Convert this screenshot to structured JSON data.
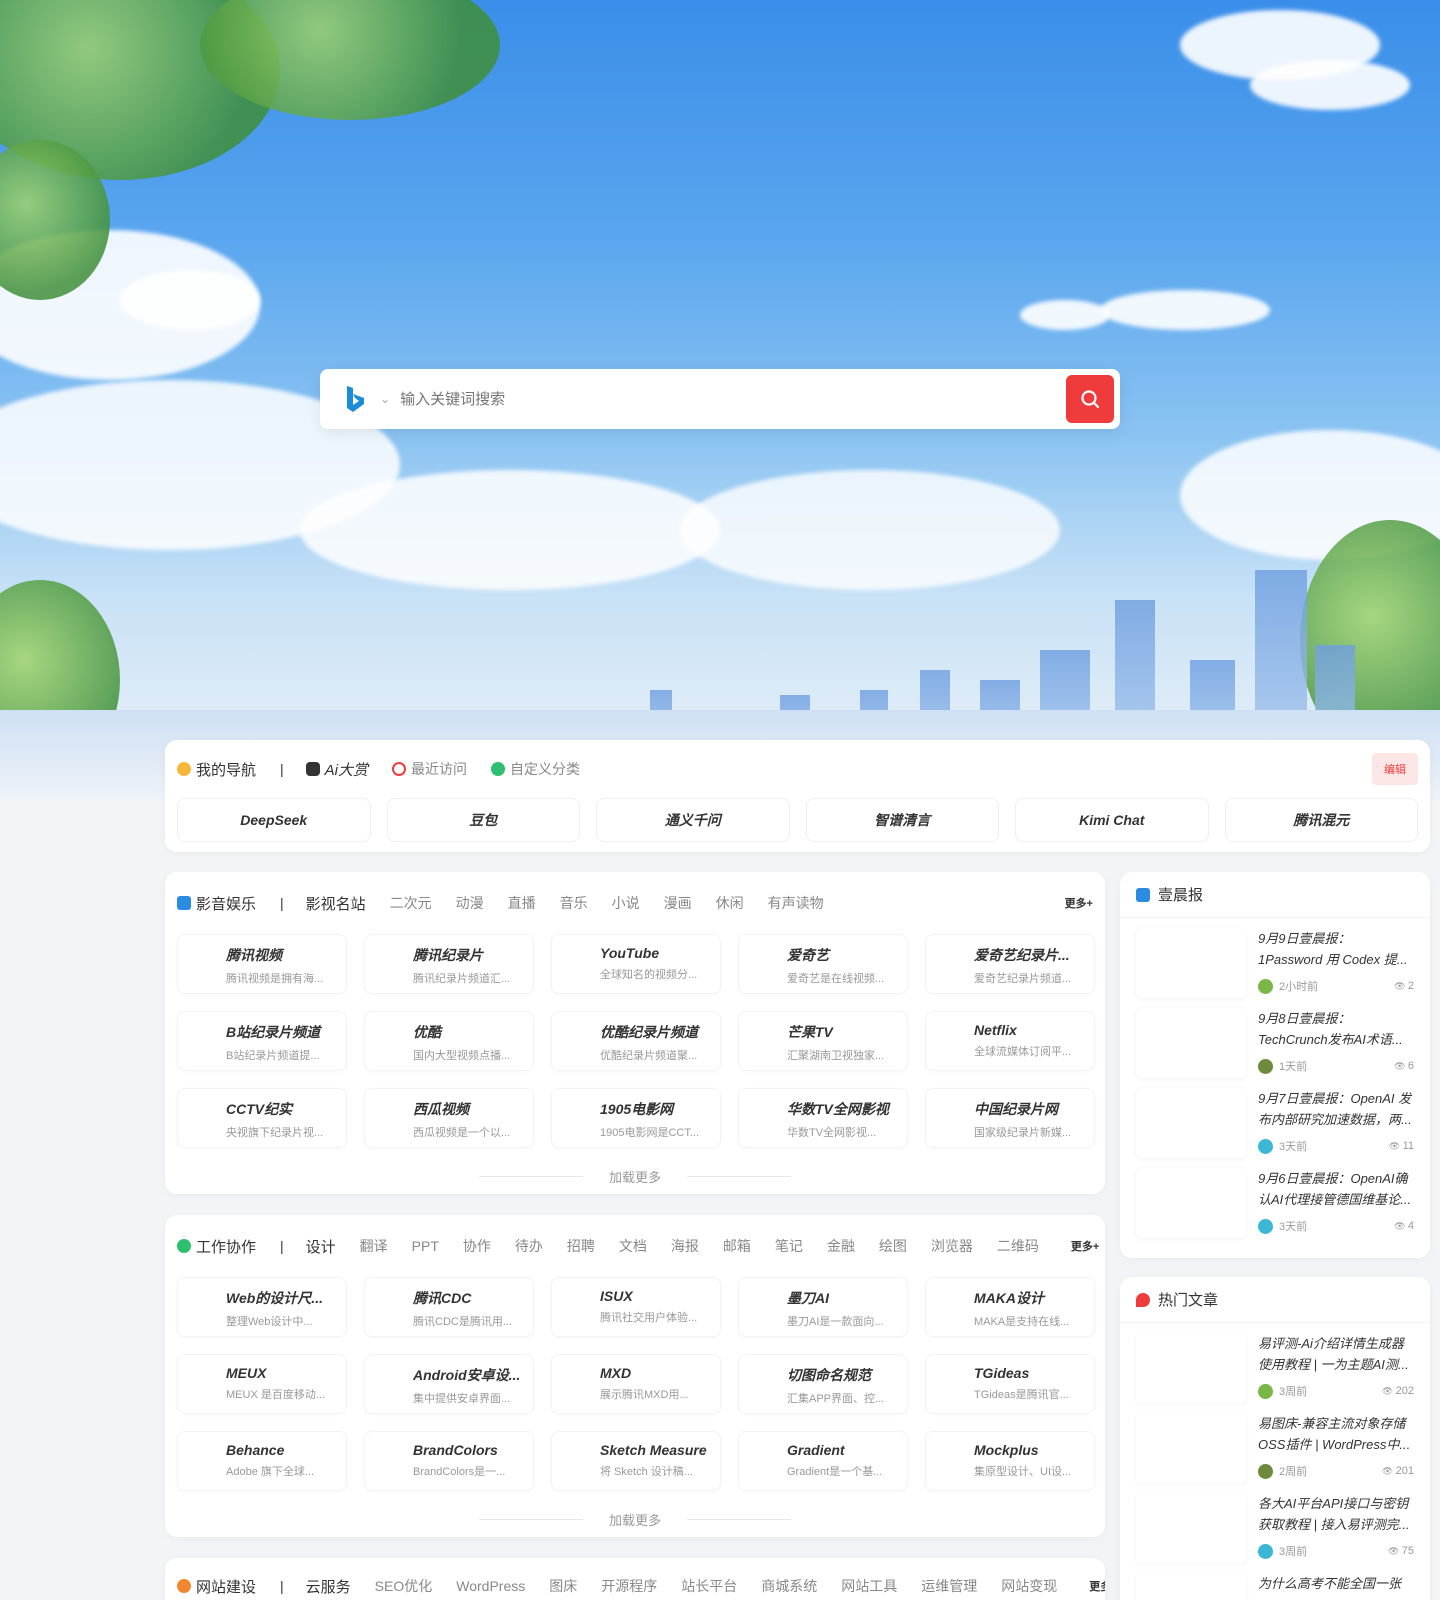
{
  "search": {
    "placeholder": "输入关键词搜索"
  },
  "my_nav": {
    "tabs": [
      {
        "label": "我的导航",
        "icon": "star-icon"
      },
      {
        "label": "Ai大赏",
        "icon": "robot-icon"
      },
      {
        "label": "最近访问",
        "icon": "clock-icon"
      },
      {
        "label": "自定义分类",
        "icon": "plus-circle-icon"
      }
    ],
    "edit_label": "编辑",
    "items": [
      "DeepSeek",
      "豆包",
      "通义千问",
      "智谱清言",
      "Kimi Chat",
      "腾讯混元"
    ]
  },
  "entertainment": {
    "title": "影音娱乐",
    "active_tab": "影视名站",
    "tabs": [
      "二次元",
      "动漫",
      "直播",
      "音乐",
      "小说",
      "漫画",
      "休闲",
      "有声读物"
    ],
    "more": "更多+",
    "sites": [
      {
        "name": "腾讯视频",
        "desc": "腾讯视频是拥有海..."
      },
      {
        "name": "腾讯纪录片",
        "desc": "腾讯纪录片频道汇..."
      },
      {
        "name": "YouTube",
        "desc": "全球知名的视频分..."
      },
      {
        "name": "爱奇艺",
        "desc": "爱奇艺是在线视频..."
      },
      {
        "name": "爱奇艺纪录片...",
        "desc": "爱奇艺纪录片频道..."
      },
      {
        "name": "B站纪录片频道",
        "desc": "B站纪录片频道提..."
      },
      {
        "name": "优酷",
        "desc": "国内大型视频点播..."
      },
      {
        "name": "优酷纪录片频道",
        "desc": "优酷纪录片频道聚..."
      },
      {
        "name": "芒果TV",
        "desc": "汇聚湖南卫视独家..."
      },
      {
        "name": "Netflix",
        "desc": "全球流媒体订阅平..."
      },
      {
        "name": "CCTV纪实",
        "desc": "央视旗下纪录片视..."
      },
      {
        "name": "西瓜视频",
        "desc": "西瓜视频是一个以..."
      },
      {
        "name": "1905电影网",
        "desc": "1905电影网是CCT..."
      },
      {
        "name": "华数TV全网影视",
        "desc": "华数TV全网影视..."
      },
      {
        "name": "中国纪录片网",
        "desc": "国家级纪录片新媒..."
      }
    ],
    "load_more": "加载更多"
  },
  "work": {
    "title": "工作协作",
    "active_tab": "设计",
    "tabs": [
      "翻译",
      "PPT",
      "协作",
      "待办",
      "招聘",
      "文档",
      "海报",
      "邮箱",
      "笔记",
      "金融",
      "绘图",
      "浏览器",
      "二维码"
    ],
    "more": "更多+",
    "sites": [
      {
        "name": "Web的设计尺...",
        "desc": "整理Web设计中..."
      },
      {
        "name": "腾讯CDC",
        "desc": "腾讯CDC是腾讯用..."
      },
      {
        "name": "ISUX",
        "desc": "腾讯社交用户体验..."
      },
      {
        "name": "墨刀AI",
        "desc": "墨刀AI是一款面向..."
      },
      {
        "name": "MAKA设计",
        "desc": "MAKA是支持在线..."
      },
      {
        "name": "MEUX",
        "desc": "MEUX 是百度移动..."
      },
      {
        "name": "Android安卓设...",
        "desc": "集中提供安卓界面..."
      },
      {
        "name": "MXD",
        "desc": "展示腾讯MXD用..."
      },
      {
        "name": "切图命名规范",
        "desc": "汇集APP界面、控..."
      },
      {
        "name": "TGideas",
        "desc": "TGideas是腾讯官..."
      },
      {
        "name": "Behance",
        "desc": "Adobe 旗下全球..."
      },
      {
        "name": "BrandColors",
        "desc": "BrandColors是一..."
      },
      {
        "name": "Sketch Measure",
        "desc": "将 Sketch 设计稿..."
      },
      {
        "name": "Gradient",
        "desc": "Gradient是一个基..."
      },
      {
        "name": "Mockplus",
        "desc": "集原型设计、UI设..."
      }
    ],
    "load_more": "加载更多"
  },
  "web": {
    "title": "网站建设",
    "active_tab": "云服务",
    "tabs": [
      "SEO优化",
      "WordPress",
      "图床",
      "开源程序",
      "站长平台",
      "商城系统",
      "网站工具",
      "运维管理",
      "网站变现"
    ],
    "more": "更多+"
  },
  "morning_news": {
    "title": "壹晨报",
    "items": [
      {
        "title": "9月9日壹晨报：1Password 用 Codex 提...",
        "time": "2小时前",
        "views": "2"
      },
      {
        "title": "9月8日壹晨报：TechCrunch发布AI术语...",
        "time": "1天前",
        "views": "6"
      },
      {
        "title": "9月7日壹晨报：OpenAI 发布内部研究加速数据，两...",
        "time": "3天前",
        "views": "11"
      },
      {
        "title": "9月6日壹晨报：OpenAI确认AI代理接管德国维基论...",
        "time": "3天前",
        "views": "4"
      }
    ]
  },
  "hot_articles": {
    "title": "热门文章",
    "items": [
      {
        "title": "易评测-Ai介绍详情生成器使用教程 | 一为主题AI测...",
        "time": "3周前",
        "views": "202"
      },
      {
        "title": "易图床-兼容主流对象存储OSS插件 | WordPress中...",
        "time": "2周前",
        "views": "201"
      },
      {
        "title": "各大AI平台API接口与密钥获取教程 | 接入易评测完...",
        "time": "3周前",
        "views": "75"
      },
      {
        "title": "为什么高考不能全国一张",
        "time": "",
        "views": ""
      }
    ]
  },
  "colors": {
    "accent": "#ef3b3b",
    "sky": "#3a8ee9"
  }
}
